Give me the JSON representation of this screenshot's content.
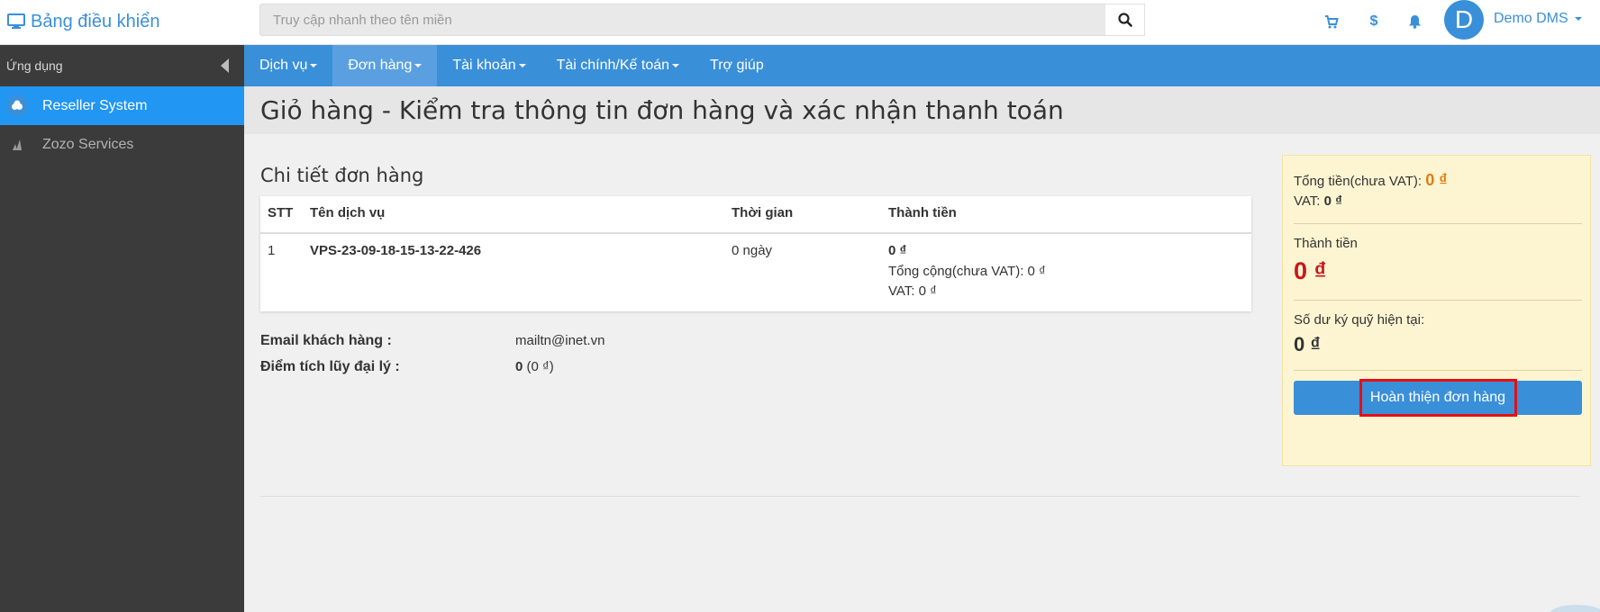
{
  "header": {
    "brand": "Bảng điều khiển",
    "search_placeholder": "Truy cập nhanh theo tên miền",
    "user_initial": "D",
    "user_name": "Demo DMS",
    "currency_symbol": "$"
  },
  "sidebar": {
    "heading": "Ứng dụng",
    "items": [
      {
        "label": "Reseller System"
      },
      {
        "label": "Zozo Services"
      }
    ]
  },
  "nav": {
    "items": [
      {
        "label": "Dịch vụ"
      },
      {
        "label": "Đơn hàng"
      },
      {
        "label": "Tài khoản"
      },
      {
        "label": "Tài chính/Kế toán"
      },
      {
        "label": "Trợ giúp"
      }
    ]
  },
  "page": {
    "title": "Giỏ hàng - Kiểm tra thông tin đơn hàng và xác nhận thanh toán"
  },
  "order": {
    "section_title": "Chi tiết đơn hàng",
    "columns": [
      "STT",
      "Tên dịch vụ",
      "Thời gian",
      "Thành tiền"
    ],
    "rows": [
      {
        "stt": "1",
        "service": "VPS-23-09-18-15-13-22-426",
        "duration": "0 ngày",
        "amount": "0 ₫",
        "subtotal": "Tổng cộng(chưa VAT): 0 ₫",
        "vat": "VAT: 0 ₫"
      }
    ]
  },
  "customer": {
    "email_label": "Email khách hàng :",
    "email_value": "mailtn@inet.vn",
    "points_label": "Điểm tích lũy đại lý :",
    "points_value": "0",
    "points_money": "(0 ₫)"
  },
  "summary": {
    "subtotal_label": "Tổng tiền(chưa VAT):",
    "subtotal_value": "0 ₫",
    "vat_label": "VAT:",
    "vat_value": "0 ₫",
    "total_label": "Thành tiền",
    "total_value": "0 ₫",
    "balance_label": "Số dư ký quỹ hiện tại:",
    "balance_value": "0 ₫",
    "button_label": "Hoàn thiện đơn hàng"
  },
  "colors": {
    "primary": "#3a8fd9",
    "sidebar_bg": "#3b3b3b",
    "active_item": "#2196f3",
    "total_red": "#c9161d",
    "highlight_red": "#e60f14",
    "summary_bg": "#fdf5d2"
  }
}
